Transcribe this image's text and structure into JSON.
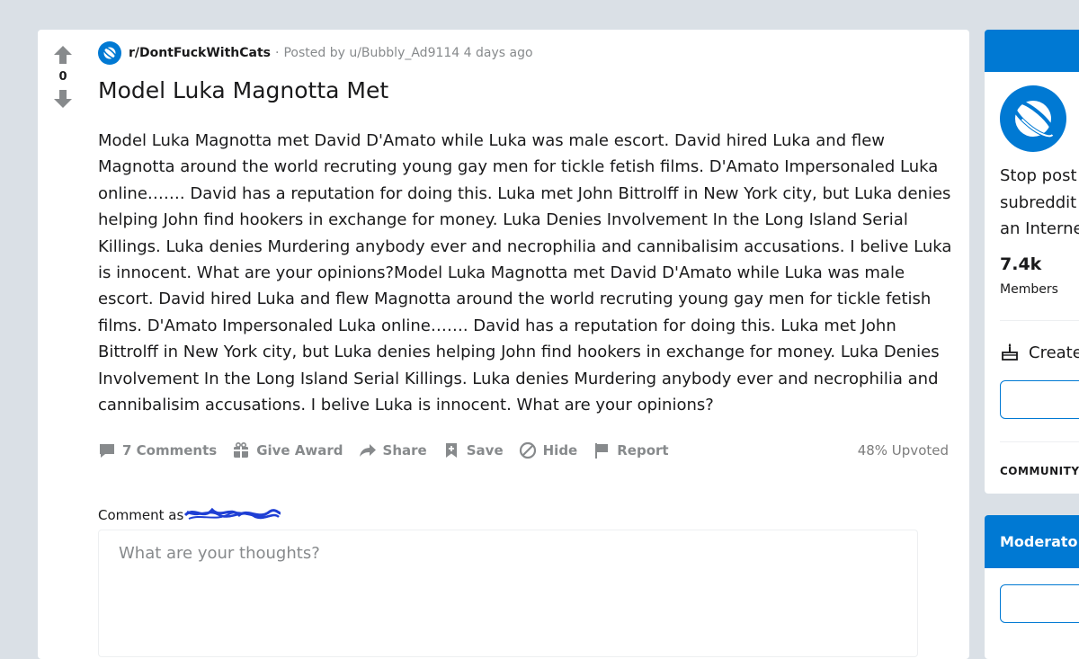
{
  "post": {
    "vote_count": "0",
    "subreddit": "r/DontFuckWithCats",
    "separator": "·",
    "posted_by": "Posted by u/Bubbly_Ad9114 4 days ago",
    "title": "Model Luka Magnotta Met",
    "body": "Model Luka Magnotta met David D'Amato while Luka was male escort. David hired Luka and flew Magnotta around the world recruting young gay men for tickle fetish films. D'Amato Impersonaled Luka online……. David has a reputation for doing this. Luka met John Bittrolff in New York city, but Luka denies helping John find hookers in exchange for money. Luka Denies Involvement In the Long Island Serial Killings. Luka denies Murdering anybody ever and necrophilia and cannibalisim accusations. I belive Luka is innocent. What are your opinions?Model Luka Magnotta met David D'Amato while Luka was male escort. David hired Luka and flew Magnotta around the world recruting young gay men for tickle fetish films. D'Amato Impersonaled Luka online……. David has a reputation for doing this. Luka met John Bittrolff in New York city, but Luka denies helping John find hookers in exchange for money. Luka Denies Involvement In the Long Island Serial Killings. Luka denies Murdering anybody ever and necrophilia and cannibalisim accusations. I belive Luka is innocent. What are your opinions?",
    "upvoted": "48% Upvoted"
  },
  "actions": {
    "comments": "7 Comments",
    "give_award": "Give Award",
    "share": "Share",
    "save": "Save",
    "hide": "Hide",
    "report": "Report"
  },
  "comment": {
    "comment_as": "Comment as",
    "placeholder": "What are your thoughts?"
  },
  "sidebar": {
    "description": "Stop post\nsubreddit\nan Interne",
    "members_count": "7.4k",
    "members_label": "Members",
    "create_label": "Create",
    "community_label": "COMMUNITY"
  },
  "moderators": {
    "title": "Moderato"
  },
  "colors": {
    "accent": "#0079d3",
    "background": "#dae0e6",
    "muted": "#878a8c"
  }
}
